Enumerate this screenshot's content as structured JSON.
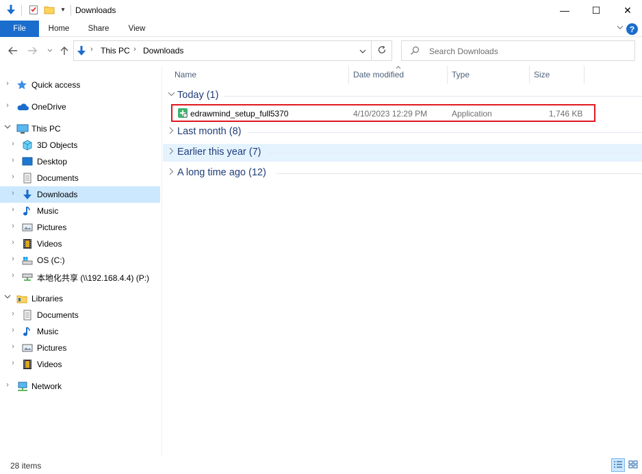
{
  "window": {
    "title": "Downloads",
    "controls": {
      "minimize": "—",
      "maximize": "☐",
      "close": "✕"
    }
  },
  "ribbon": {
    "tabs": [
      "File",
      "Home",
      "Share",
      "View"
    ],
    "help": "?"
  },
  "address": {
    "crumbs": [
      "This PC",
      "Downloads"
    ],
    "search_placeholder": "Search Downloads"
  },
  "nav": {
    "items": [
      {
        "label": "Quick access",
        "icon": "star-icon"
      },
      {
        "label": "OneDrive",
        "icon": "cloud-icon"
      },
      {
        "label": "This PC",
        "icon": "computer-icon"
      },
      {
        "label": "3D Objects",
        "icon": "cube-icon"
      },
      {
        "label": "Desktop",
        "icon": "desktop-icon"
      },
      {
        "label": "Documents",
        "icon": "document-icon"
      },
      {
        "label": "Downloads",
        "icon": "download-icon"
      },
      {
        "label": "Music",
        "icon": "music-icon"
      },
      {
        "label": "Pictures",
        "icon": "picture-icon"
      },
      {
        "label": "Videos",
        "icon": "video-icon"
      },
      {
        "label": "OS (C:)",
        "icon": "drive-icon"
      },
      {
        "label": "本地化共享 (\\\\192.168.4.4) (P:)",
        "icon": "network-drive-icon"
      },
      {
        "label": "Libraries",
        "icon": "library-icon"
      },
      {
        "label": "Documents",
        "icon": "document-icon"
      },
      {
        "label": "Music",
        "icon": "music-icon"
      },
      {
        "label": "Pictures",
        "icon": "picture-icon"
      },
      {
        "label": "Videos",
        "icon": "video-icon"
      },
      {
        "label": "Network",
        "icon": "network-icon"
      }
    ]
  },
  "columns": {
    "name": "Name",
    "date": "Date modified",
    "type": "Type",
    "size": "Size"
  },
  "groups": [
    {
      "title": "Today (1)"
    },
    {
      "title": "Last month (8)"
    },
    {
      "title": "Earlier this year (7)"
    },
    {
      "title": "A long time ago (12)"
    }
  ],
  "files": [
    {
      "name": "edrawmind_setup_full5370",
      "date": "4/10/2023 12:29 PM",
      "type": "Application",
      "size": "1,746 KB"
    }
  ],
  "status": {
    "items": "28 items"
  },
  "colors": {
    "accent": "#1a6dcc",
    "selection": "#cce8ff",
    "highlight_border": "#e0161c",
    "group_title": "#1e3c78"
  }
}
